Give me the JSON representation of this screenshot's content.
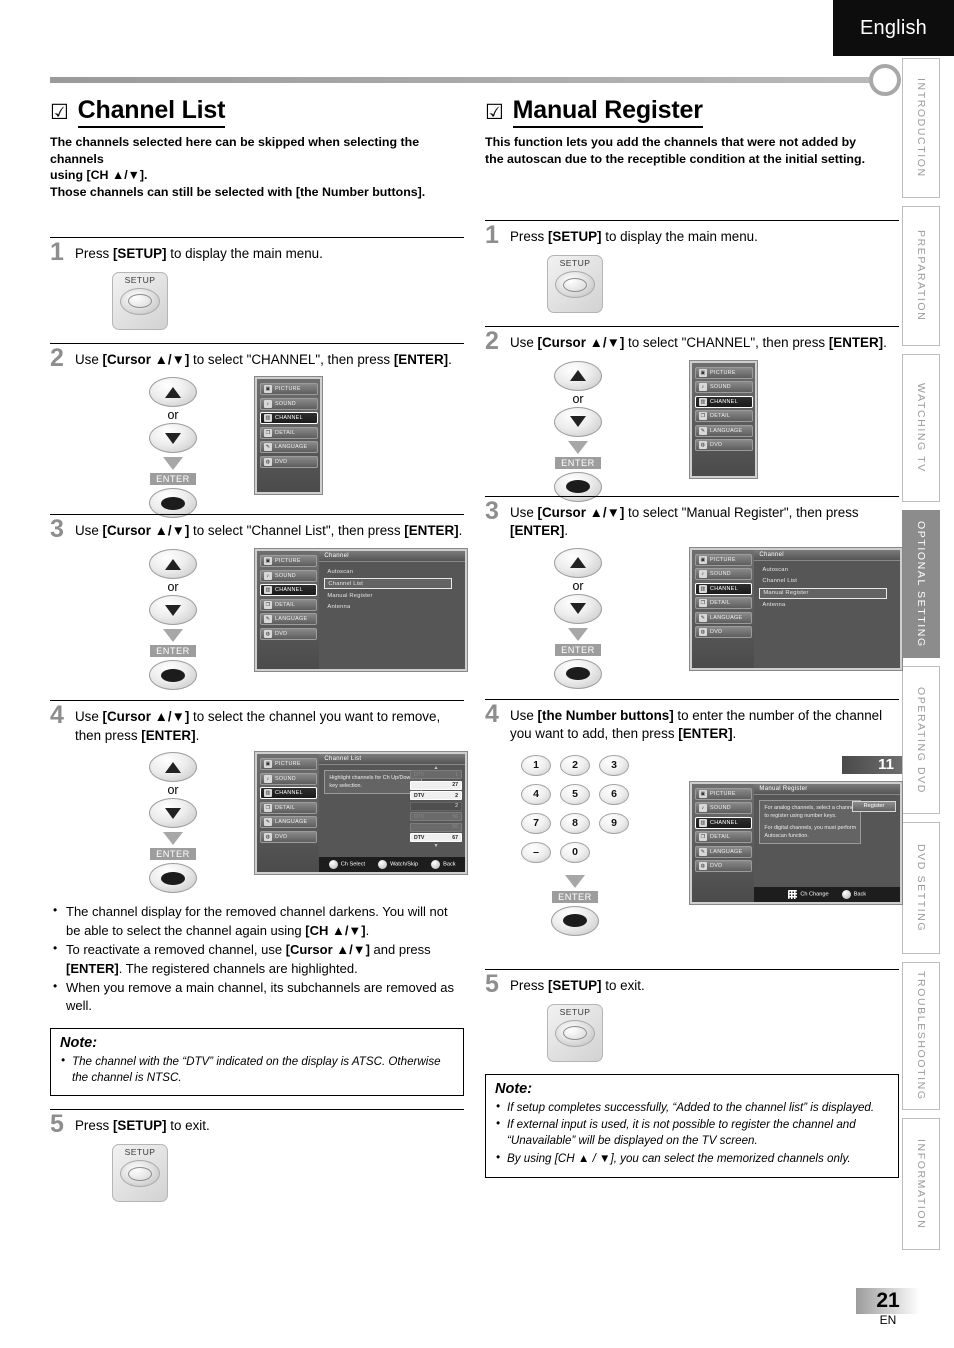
{
  "header": {
    "language_tab": "English"
  },
  "side_tabs": [
    {
      "label": "INTRODUCTION",
      "active": false
    },
    {
      "label": "PREPARATION",
      "active": false
    },
    {
      "label": "WATCHING  TV",
      "active": false
    },
    {
      "label": "OPTIONAL  SETTING",
      "active": true
    },
    {
      "label": "OPERATING  DVD",
      "active": false
    },
    {
      "label": "DVD  SETTING",
      "active": false
    },
    {
      "label": "TROUBLESHOOTING",
      "active": false
    },
    {
      "label": "INFORMATION",
      "active": false
    }
  ],
  "footer": {
    "page_number": "21",
    "page_lang": "EN"
  },
  "left": {
    "tick": "☑",
    "title": "Channel List",
    "lead": "The channels selected here can be skipped when selecting the channels using [CH ▲/▼].\nThose channels can still be selected with [the Number buttons].",
    "lead_line1": "The channels selected here can be skipped when selecting the channels",
    "lead_line2a": "using ",
    "lead_line2b": "[CH ▲/▼]",
    "lead_line2c": ".",
    "lead_line3a": "Those channels can still be selected with ",
    "lead_line3b": "[the Number buttons]",
    "lead_line3c": ".",
    "steps": [
      {
        "num": "1",
        "text_pre": "Press ",
        "text_bold": "[SETUP]",
        "text_post": " to display the main menu."
      },
      {
        "num": "2",
        "text_pre": "Use ",
        "text_bold": "[Cursor ▲/▼]",
        "text_mid": " to select \"CHANNEL\", then press ",
        "text_bold2": "[ENTER]",
        "text_post": "."
      },
      {
        "num": "3",
        "text_pre": "Use ",
        "text_bold": "[Cursor ▲/▼]",
        "text_mid": " to select \"Channel List\", then press ",
        "text_bold2": "[ENTER]",
        "text_post": "."
      },
      {
        "num": "4",
        "text_pre": "Use ",
        "text_bold": "[Cursor ▲/▼]",
        "text_mid": " to select the channel you want to remove, then press ",
        "text_bold2": "[ENTER]",
        "text_post": "."
      },
      {
        "num": "5",
        "text_pre": "Press ",
        "text_bold": "[SETUP]",
        "text_post": " to exit."
      }
    ],
    "bullets": [
      {
        "a": "The channel display for the removed channel darkens. You will not be able to select the channel again using ",
        "b": "[CH ▲/▼]",
        "c": "."
      },
      {
        "a": "To reactivate a removed channel, use ",
        "b": "[Cursor ▲/▼]",
        "c": " and press ",
        "d": "[ENTER]",
        "e": ". The registered channels are highlighted."
      },
      {
        "a": "When you remove a main channel, its subchannels are removed as well.",
        "b": "",
        "c": ""
      }
    ],
    "note": {
      "title": "Note:",
      "items": [
        "The channel with the “DTV” indicated on the display is ATSC. Otherwise the channel is NTSC."
      ]
    }
  },
  "right": {
    "tick": "☑",
    "title": "Manual Register",
    "lead_line1": "This function lets you add the channels that were not added by",
    "lead_line2": "the autoscan due to the receptible condition at the initial setting.",
    "steps": [
      {
        "num": "1",
        "text_pre": "Press ",
        "text_bold": "[SETUP]",
        "text_post": " to display the main menu."
      },
      {
        "num": "2",
        "text_pre": "Use ",
        "text_bold": "[Cursor ▲/▼]",
        "text_mid": " to select \"CHANNEL\", then press ",
        "text_bold2": "[ENTER]",
        "text_post": "."
      },
      {
        "num": "3",
        "text_pre": "Use ",
        "text_bold": "[Cursor ▲/▼]",
        "text_mid": " to select \"Manual Register\", then press ",
        "text_bold2": "[ENTER]",
        "text_post": "."
      },
      {
        "num": "4",
        "text_pre": "Use ",
        "text_bold": "[the Number buttons]",
        "text_mid": " to enter the number of the channel you want to add, then press ",
        "text_bold2": "[ENTER]",
        "text_post": "."
      },
      {
        "num": "5",
        "text_pre": "Press ",
        "text_bold": "[SETUP]",
        "text_post": " to exit."
      }
    ],
    "note": {
      "title": "Note:",
      "items": [
        "If setup completes successfully, “Added to the channel list” is displayed.",
        "If external input is used, it is not possible to register the channel and “Unavailable” will be displayed on the TV screen.",
        "By using [CH ▲ / ▼], you can select the memorized channels only."
      ]
    }
  },
  "remote": {
    "setup_label": "SETUP",
    "enter_label": "ENTER",
    "or_label": "or",
    "keypad": [
      [
        "1",
        "2",
        "3"
      ],
      [
        "4",
        "5",
        "6"
      ],
      [
        "7",
        "8",
        "9"
      ],
      [
        "–",
        "0",
        ""
      ]
    ]
  },
  "osd": {
    "main_menu": [
      {
        "label": "PICTURE",
        "icon": "picture-icon",
        "selected": false
      },
      {
        "label": "SOUND",
        "icon": "sound-icon",
        "selected": false
      },
      {
        "label": "CHANNEL",
        "icon": "channel-icon",
        "selected": true
      },
      {
        "label": "DETAIL",
        "icon": "detail-icon",
        "selected": false
      },
      {
        "label": "LANGUAGE",
        "icon": "language-icon",
        "selected": false
      },
      {
        "label": "DVD",
        "icon": "dvd-icon",
        "selected": false
      }
    ],
    "channel_menu_title": "Channel",
    "channel_menu_items": [
      "Autoscan",
      "Channel List",
      "Manual Register",
      "Antenna"
    ],
    "channel_list_title": "Channel List",
    "channel_list_hint": "Highlight channels for Ch Up/Down key selection.",
    "channel_list_rows": [
      {
        "type": "DTV",
        "num": "1",
        "state": "dim"
      },
      {
        "type": "",
        "num": "27",
        "state": "on"
      },
      {
        "type": "DTV",
        "num": "2",
        "state": "on"
      },
      {
        "type": "",
        "num": "2",
        "state": "plain"
      },
      {
        "type": "DTV",
        "num": "56",
        "state": "dim"
      },
      {
        "type": "",
        "num": "56",
        "state": "dim"
      },
      {
        "type": "DTV",
        "num": "67",
        "state": "on"
      }
    ],
    "channel_list_footer": [
      {
        "icon": "dpad-icon",
        "label": "Ch Select",
        "tiny": ""
      },
      {
        "icon": "enter-icon",
        "label": "Watch/Skip",
        "tiny": ""
      },
      {
        "icon": "back-icon",
        "label": "Back",
        "tiny": "BACK"
      }
    ],
    "manual_register_title": "Manual Register",
    "manual_register_note1": "For analog channels, select a channel to register using number keys.",
    "manual_register_note2": "For digital channels, you must perform Autoscan function.",
    "manual_register_button": "Register",
    "manual_register_footer": [
      {
        "icon": "numpad-icon",
        "label": "Ch Change",
        "tiny": ""
      },
      {
        "icon": "back-icon",
        "label": "Back",
        "tiny": "BACK"
      }
    ],
    "channel_badge": "11"
  }
}
